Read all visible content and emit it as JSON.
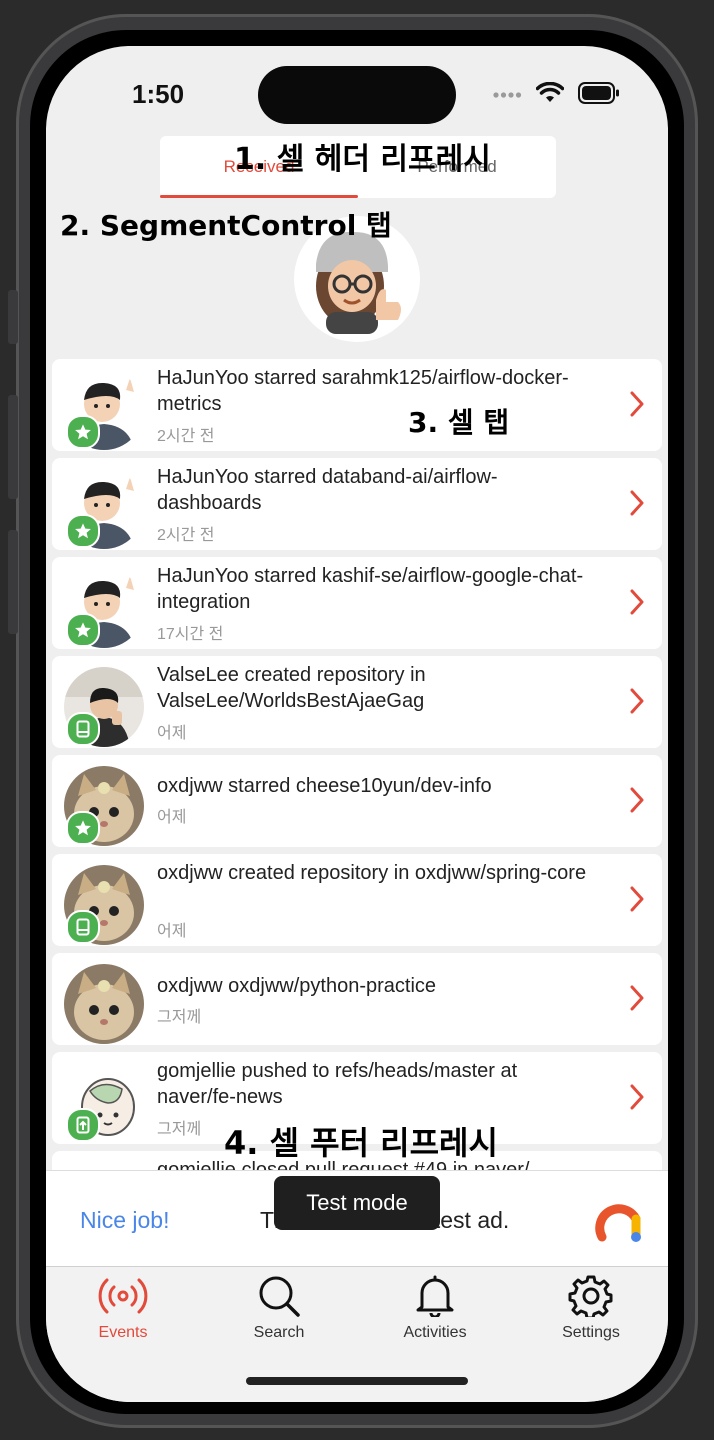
{
  "status_bar": {
    "time": "1:50"
  },
  "segment_control": {
    "tabs": [
      "Received",
      "Performed"
    ],
    "selected": "Received"
  },
  "annotations": {
    "a1": "1. 셀 헤더 리프레시",
    "a2": "2. SegmentControl 탭",
    "a3": "3. 셀 탭",
    "a4": "4. 셀 푸터 리프레시"
  },
  "feed": [
    {
      "title": "HaJunYoo starred sarahmk125/airflow-docker-metrics",
      "time": "2시간 전",
      "badge": "star-icon"
    },
    {
      "title": "HaJunYoo starred databand-ai/airflow-dashboards",
      "time": "2시간 전",
      "badge": "star-icon"
    },
    {
      "title": "HaJunYoo starred kashif-se/airflow-google-chat-integration",
      "time": "17시간 전",
      "badge": "star-icon"
    },
    {
      "title": "ValseLee created repository  in ValseLee/WorldsBestAjaeGag",
      "time": "어제",
      "badge": "repository-icon"
    },
    {
      "title": "oxdjww starred cheese10yun/dev-info",
      "time": "어제",
      "badge": "star-icon"
    },
    {
      "title": "oxdjww created repository  in oxdjww/spring-core",
      "time": "어제",
      "badge": "repository-icon"
    },
    {
      "title": "oxdjww  oxdjww/python-practice",
      "time": "그저께",
      "badge": ""
    },
    {
      "title": "gomjellie pushed to refs/heads/master at naver/fe-news",
      "time": "그저께",
      "badge": "push-icon"
    },
    {
      "title": "gomjellie closed pull request #49 in naver/",
      "time": "",
      "badge": ""
    }
  ],
  "ad": {
    "nice": "Nice job!",
    "text": "This is a 320x50 test ad.",
    "toast": "Test mode"
  },
  "tabbar": {
    "items": [
      {
        "label": "Events",
        "icon": "broadcast-icon",
        "active": true
      },
      {
        "label": "Search",
        "icon": "search-icon",
        "active": false
      },
      {
        "label": "Activities",
        "icon": "bell-icon",
        "active": false
      },
      {
        "label": "Settings",
        "icon": "gear-icon",
        "active": false
      }
    ]
  },
  "colors": {
    "accent": "#e24a3b",
    "badge_green": "#4caf50",
    "ad_blue": "#4a86e8"
  }
}
